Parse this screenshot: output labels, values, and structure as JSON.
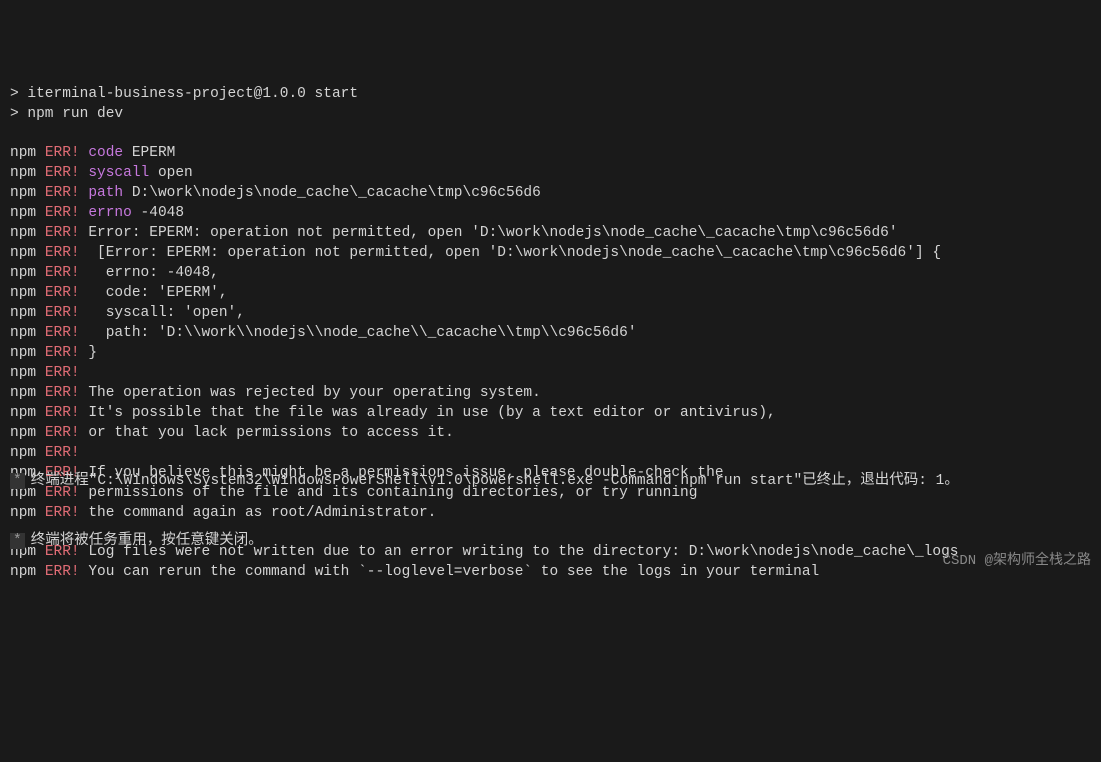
{
  "prompt1": "> iterminal-business-project@1.0.0 start",
  "prompt2": "> npm run dev",
  "lines": [
    {
      "type": "kv",
      "key": "code",
      "val": "EPERM"
    },
    {
      "type": "kv",
      "key": "syscall",
      "val": "open"
    },
    {
      "type": "kv",
      "key": "path",
      "val": "D:\\work\\nodejs\\node_cache\\_cacache\\tmp\\c96c56d6"
    },
    {
      "type": "kv",
      "key": "errno",
      "val": "-4048"
    },
    {
      "type": "msg",
      "text": "Error: EPERM: operation not permitted, open 'D:\\work\\nodejs\\node_cache\\_cacache\\tmp\\c96c56d6'"
    },
    {
      "type": "msg",
      "text": " [Error: EPERM: operation not permitted, open 'D:\\work\\nodejs\\node_cache\\_cacache\\tmp\\c96c56d6'] {"
    },
    {
      "type": "msg",
      "text": "  errno: -4048,"
    },
    {
      "type": "msg",
      "text": "  code: 'EPERM',"
    },
    {
      "type": "msg",
      "text": "  syscall: 'open',"
    },
    {
      "type": "msg",
      "text": "  path: 'D:\\\\work\\\\nodejs\\\\node_cache\\\\_cacache\\\\tmp\\\\c96c56d6'"
    },
    {
      "type": "msg",
      "text": "}"
    },
    {
      "type": "msg",
      "text": ""
    },
    {
      "type": "msg",
      "text": "The operation was rejected by your operating system."
    },
    {
      "type": "msg",
      "text": "It's possible that the file was already in use (by a text editor or antivirus),"
    },
    {
      "type": "msg",
      "text": "or that you lack permissions to access it."
    },
    {
      "type": "msg",
      "text": ""
    },
    {
      "type": "msg",
      "text": "If you believe this might be a permissions issue, please double-check the"
    },
    {
      "type": "msg",
      "text": "permissions of the file and its containing directories, or try running"
    },
    {
      "type": "msg",
      "text": "the command again as root/Administrator."
    }
  ],
  "gapAfter": true,
  "tail": [
    "Log files were not written due to an error writing to the directory: D:\\work\\nodejs\\node_cache\\_logs",
    "You can rerun the command with `--loglevel=verbose` to see the logs in your terminal"
  ],
  "footer1": "终端进程\"C:\\Windows\\System32\\WindowsPowerShell\\v1.0\\powershell.exe -Command npm run start\"已终止，退出代码: 1。",
  "footer2": "终端将被任务重用，按任意键关闭。",
  "watermark": "CSDN @架构师全栈之路",
  "labels": {
    "npm": "npm",
    "err": "ERR!"
  }
}
